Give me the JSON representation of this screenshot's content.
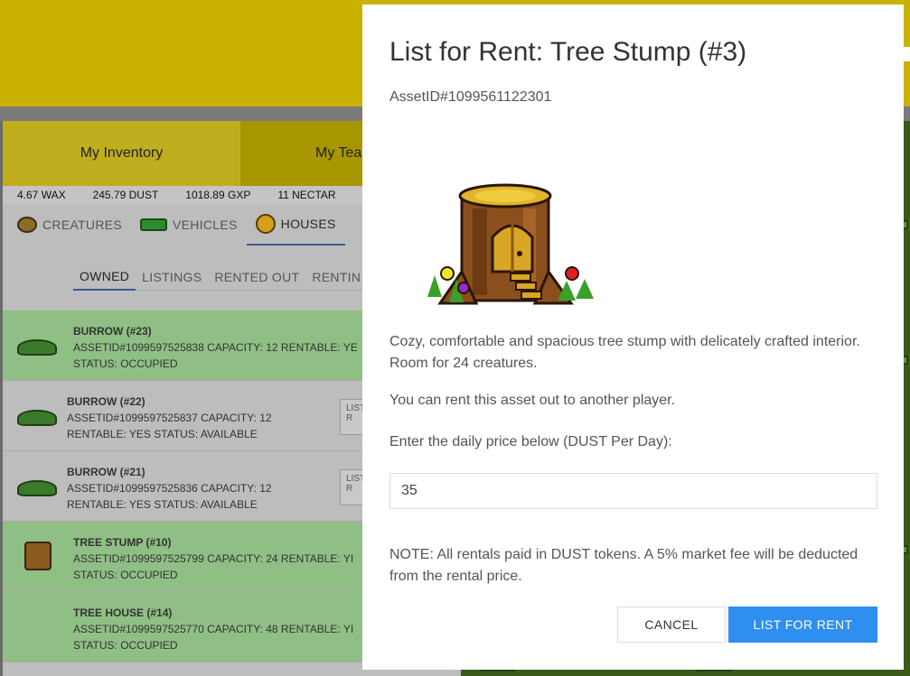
{
  "colors": {
    "banner": "#c9b200",
    "occupied_row": "#8fbf84",
    "primary_button": "#2e8ff0"
  },
  "inventory_tabs": [
    {
      "label": "My Inventory"
    },
    {
      "label": "My Tea"
    }
  ],
  "balances": {
    "wax": "4.67 WAX",
    "dust": "245.79 DUST",
    "gxp": "1018.89 GXP",
    "nectar": "11 NECTAR"
  },
  "category_tabs": [
    {
      "label": "CREATURES",
      "icon": "creature-icon"
    },
    {
      "label": "VEHICLES",
      "icon": "vehicle-icon"
    },
    {
      "label": "HOUSES",
      "icon": "house-icon",
      "active": true
    }
  ],
  "sub_tabs": [
    {
      "label": "OWNED",
      "active": true
    },
    {
      "label": "LISTINGS"
    },
    {
      "label": "RENTED OUT"
    },
    {
      "label": "RENTIN"
    }
  ],
  "assets": [
    {
      "name": "BURROW (#23)",
      "line1": "ASSETID#1099597525838 CAPACITY: 12 RENTABLE: YE",
      "line2": "STATUS: OCCUPIED"
    },
    {
      "name": "BURROW (#22)",
      "line1": "ASSETID#1099597525837 CAPACITY: 12",
      "line2": "RENTABLE: YES STATUS: AVAILABLE",
      "button": "LIST R"
    },
    {
      "name": "BURROW (#21)",
      "line1": "ASSETID#1099597525836 CAPACITY: 12",
      "line2": "RENTABLE: YES STATUS: AVAILABLE",
      "button": "LIST R"
    },
    {
      "name": "TREE STUMP (#10)",
      "line1": "ASSETID#1099597525799 CAPACITY: 24 RENTABLE: YI",
      "line2": "STATUS: OCCUPIED"
    },
    {
      "name": "TREE HOUSE (#14)",
      "line1": "ASSETID#1099597525770 CAPACITY: 48 RENTABLE: YI",
      "line2": "STATUS: OCCUPIED"
    }
  ],
  "modal": {
    "title": "List for Rent: Tree Stump (#3)",
    "asset_id": "AssetID#1099561122301",
    "image_icon": "tree-stump-icon",
    "description": "Cozy, comfortable and spacious tree stump with delicately crafted interior. Room for 24 creatures.",
    "rent_note": "You can rent this asset out to another player.",
    "price_label": "Enter the daily price below (DUST Per Day):",
    "price_value": "35",
    "note": "NOTE: All rentals paid in DUST tokens. A 5% market fee will be deducted from the rental price.",
    "cancel_label": "CANCEL",
    "submit_label": "LIST FOR RENT"
  }
}
